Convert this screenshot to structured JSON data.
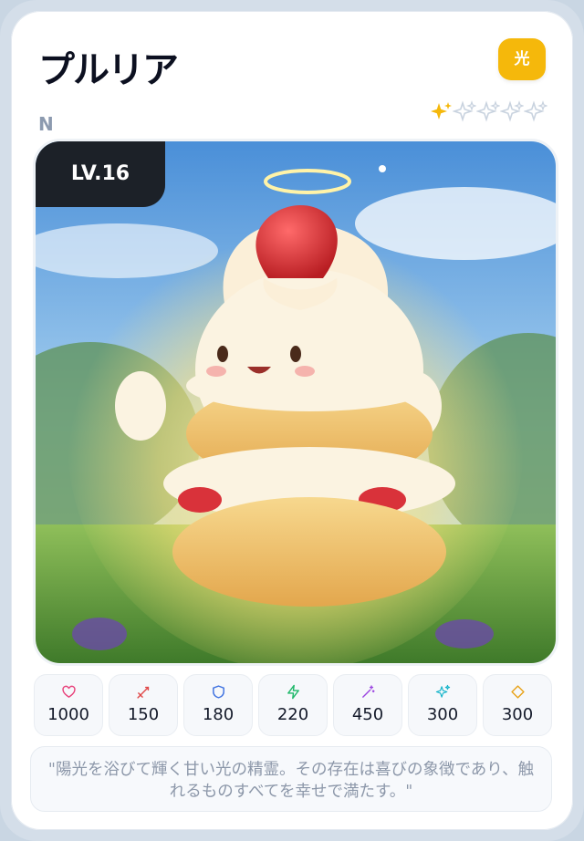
{
  "card": {
    "name": "プルリア",
    "element": "光",
    "rarity": "N",
    "stars_filled": 1,
    "stars_total": 5,
    "level": "LV.16",
    "stats": [
      {
        "icon": "heart-icon",
        "color": "#e8417a",
        "value": "1000"
      },
      {
        "icon": "sword-icon",
        "color": "#e04848",
        "value": "150"
      },
      {
        "icon": "shield-icon",
        "color": "#3b6fe0",
        "value": "180"
      },
      {
        "icon": "bolt-icon",
        "color": "#1fb86a",
        "value": "220"
      },
      {
        "icon": "magic-wand-icon",
        "color": "#9b45e0",
        "value": "450"
      },
      {
        "icon": "sparkle-icon",
        "color": "#12b3c9",
        "value": "300"
      },
      {
        "icon": "diamond-icon",
        "color": "#e8a31a",
        "value": "300"
      }
    ],
    "description": "\"陽光を浴びて輝く甘い光の精霊。その存在は喜びの象徴であり、触れるものすべてを幸せで満たす。\""
  },
  "colors": {
    "accent": "#f5b80b",
    "star_filled": "#f5b80b",
    "star_empty": "#c9d3df"
  }
}
